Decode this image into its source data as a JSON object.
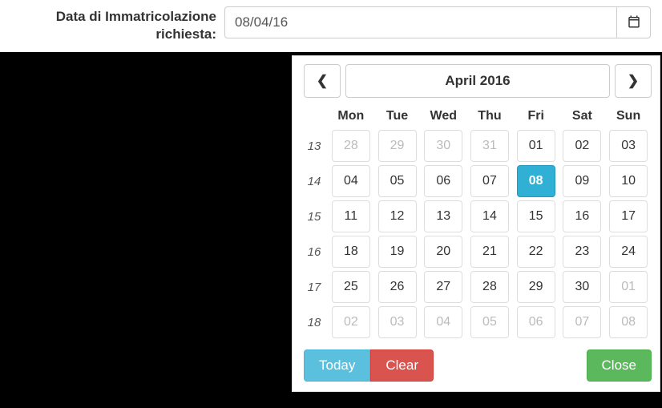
{
  "form": {
    "date_label": "Data di Immatricolazione richiesta:",
    "date_value": "08/04/16"
  },
  "datepicker": {
    "title": "April 2016",
    "weekdays": [
      "Mon",
      "Tue",
      "Wed",
      "Thu",
      "Fri",
      "Sat",
      "Sun"
    ],
    "rows": [
      {
        "week": "13",
        "days": [
          {
            "d": "28",
            "muted": true
          },
          {
            "d": "29",
            "muted": true
          },
          {
            "d": "30",
            "muted": true
          },
          {
            "d": "31",
            "muted": true
          },
          {
            "d": "01"
          },
          {
            "d": "02"
          },
          {
            "d": "03"
          }
        ]
      },
      {
        "week": "14",
        "days": [
          {
            "d": "04"
          },
          {
            "d": "05"
          },
          {
            "d": "06"
          },
          {
            "d": "07"
          },
          {
            "d": "08",
            "selected": true
          },
          {
            "d": "09"
          },
          {
            "d": "10"
          }
        ]
      },
      {
        "week": "15",
        "days": [
          {
            "d": "11"
          },
          {
            "d": "12"
          },
          {
            "d": "13"
          },
          {
            "d": "14"
          },
          {
            "d": "15"
          },
          {
            "d": "16"
          },
          {
            "d": "17"
          }
        ]
      },
      {
        "week": "16",
        "days": [
          {
            "d": "18"
          },
          {
            "d": "19"
          },
          {
            "d": "20"
          },
          {
            "d": "21"
          },
          {
            "d": "22"
          },
          {
            "d": "23"
          },
          {
            "d": "24"
          }
        ]
      },
      {
        "week": "17",
        "days": [
          {
            "d": "25"
          },
          {
            "d": "26"
          },
          {
            "d": "27"
          },
          {
            "d": "28"
          },
          {
            "d": "29"
          },
          {
            "d": "30"
          },
          {
            "d": "01",
            "muted": true
          }
        ]
      },
      {
        "week": "18",
        "days": [
          {
            "d": "02",
            "muted": true
          },
          {
            "d": "03",
            "muted": true
          },
          {
            "d": "04",
            "muted": true
          },
          {
            "d": "05",
            "muted": true
          },
          {
            "d": "06",
            "muted": true
          },
          {
            "d": "07",
            "muted": true
          },
          {
            "d": "08",
            "muted": true
          }
        ]
      }
    ],
    "buttons": {
      "today": "Today",
      "clear": "Clear",
      "close": "Close"
    }
  }
}
